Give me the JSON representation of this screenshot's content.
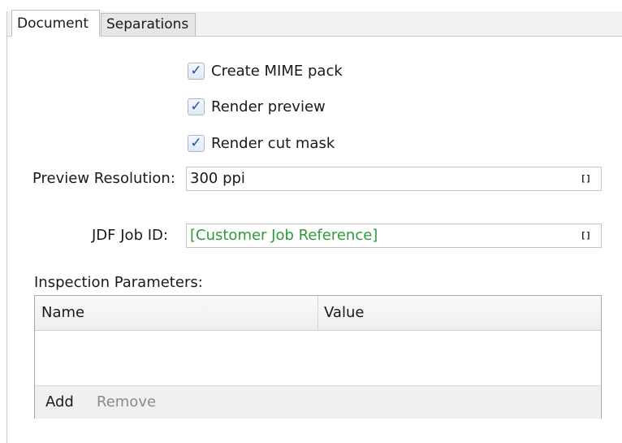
{
  "tabs": [
    {
      "label": "Document",
      "active": true
    },
    {
      "label": "Separations",
      "active": false
    }
  ],
  "options": {
    "create_mime_pack": {
      "label": "Create MIME pack",
      "checked": true
    },
    "render_preview": {
      "label": "Render preview",
      "checked": true
    },
    "render_cut_mask": {
      "label": "Render cut mask",
      "checked": true
    },
    "check_glyph": "✓"
  },
  "preview_resolution": {
    "label": "Preview Resolution:",
    "value": "300 ppi",
    "button_glyph": "[]"
  },
  "jdf_job_id": {
    "label": "JDF Job ID:",
    "value": "[Customer Job Reference]",
    "value_color": "#2e9a3a",
    "button_glyph": "[]"
  },
  "inspection": {
    "label": "Inspection Parameters:",
    "columns": [
      "Name",
      "Value"
    ],
    "rows": [],
    "add_label": "Add",
    "remove_label": "Remove"
  }
}
